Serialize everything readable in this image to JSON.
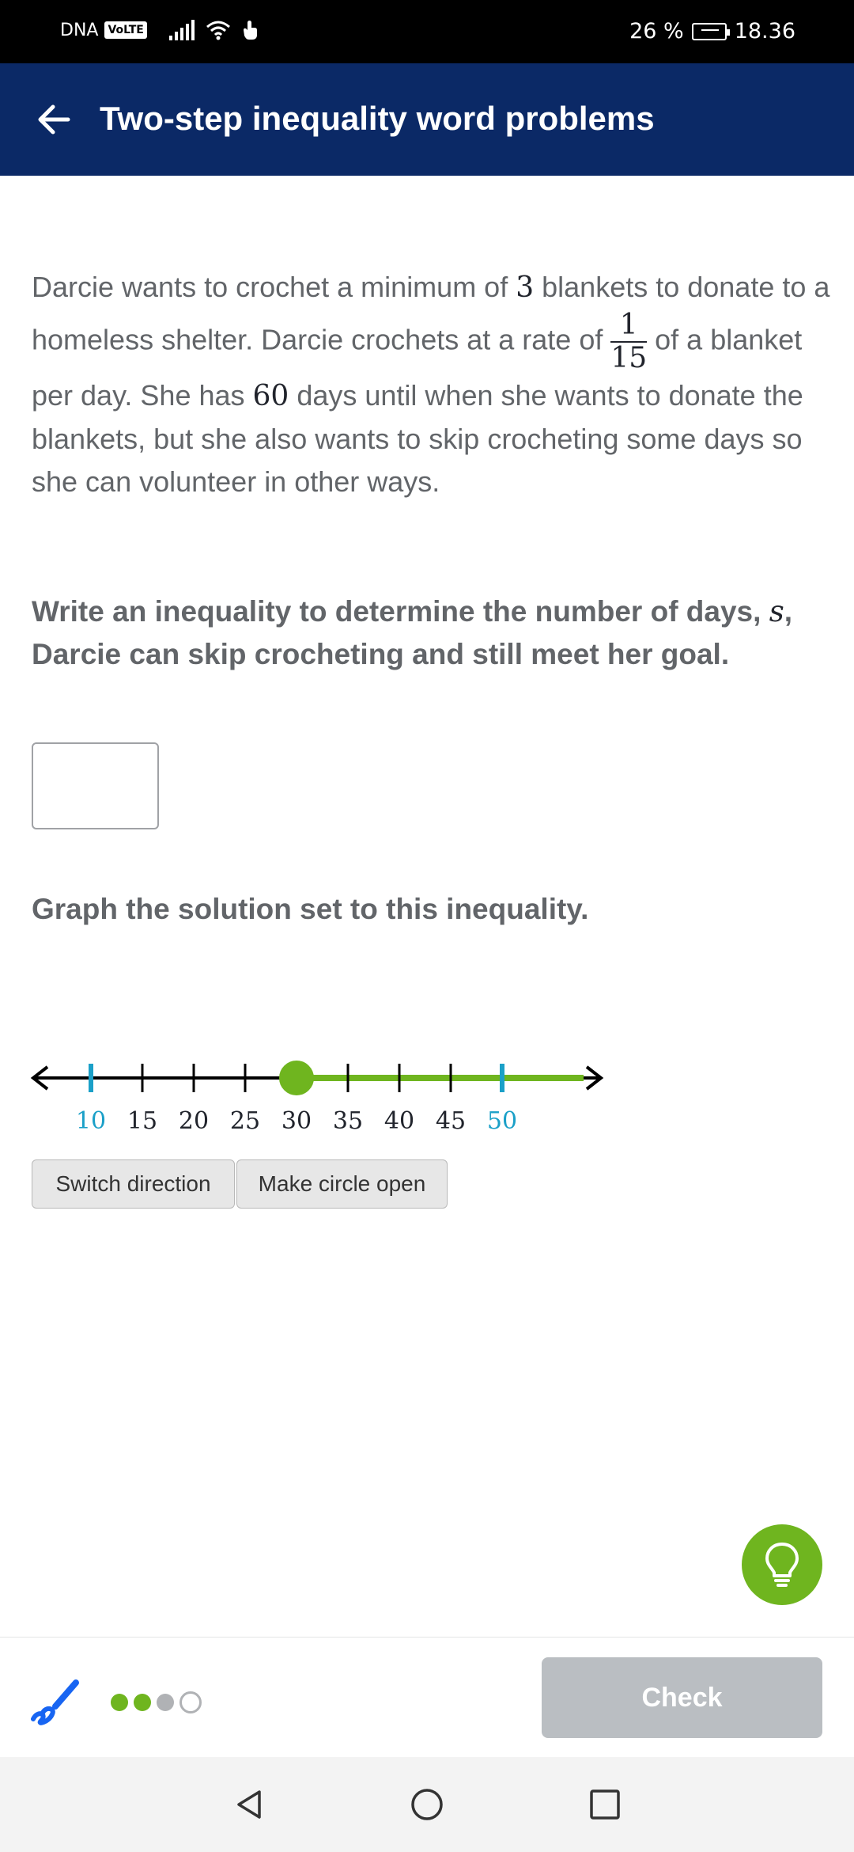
{
  "status_bar": {
    "carrier": "DNA",
    "volte": "VoLTE",
    "battery": "26 %",
    "time": "18.36"
  },
  "header": {
    "title": "Two-step inequality word problems",
    "back_icon": "arrow-left-icon"
  },
  "problem": {
    "t1": "Darcie wants to crochet a minimum of ",
    "n1": "3",
    "t2": " blankets to donate to a homeless shelter. Darcie crochets at a rate of",
    "frac_num": "1",
    "frac_den": "15",
    "t3": "of a blanket per day. She has ",
    "n2": "60",
    "t4": " days until when she wants to donate the blankets, but she also wants to skip crocheting some days so she can volunteer in other ways."
  },
  "prompt": {
    "text1": "Write an inequality to determine the number of days, ",
    "var": "s",
    "text2": ", Darcie can skip crocheting and still meet her goal."
  },
  "answer_input": {
    "value": ""
  },
  "graph_prompt": "Graph the solution set to this inequality.",
  "number_line": {
    "min": 10,
    "max": 50,
    "ticks": [
      10,
      15,
      20,
      25,
      30,
      35,
      40,
      45,
      50
    ],
    "highlighted_ticks": [
      10,
      50
    ],
    "point": 30,
    "circle": "closed",
    "direction": "right",
    "colors": {
      "line": "#000000",
      "solution": "#6fb51f",
      "endpoint_ticks": "#1ba0c8"
    }
  },
  "buttons": {
    "switch_direction": "Switch direction",
    "make_circle_open": "Make circle open"
  },
  "hint_icon": "lightbulb-icon",
  "bottom_bar": {
    "scratchpad_icon": "scratchpad-pen-icon",
    "progress": [
      "done",
      "done",
      "current",
      "todo"
    ],
    "check_label": "Check"
  },
  "nav_bar": {
    "back_icon": "triangle-back-icon",
    "home_icon": "circle-home-icon",
    "recents_icon": "square-recents-icon"
  },
  "colors": {
    "header_bg": "#0b2966",
    "accent_green": "#6fb51f",
    "check_disabled": "#babec2"
  }
}
